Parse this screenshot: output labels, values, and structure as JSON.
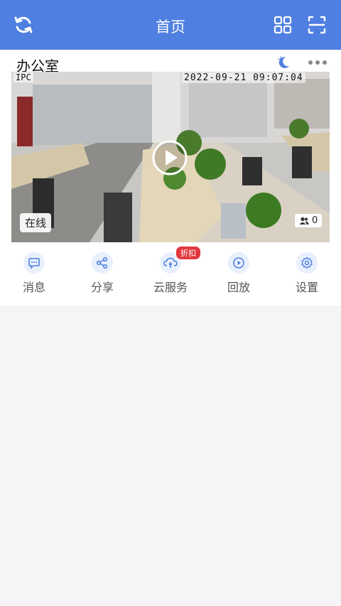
{
  "header": {
    "title": "首页"
  },
  "camera": {
    "name": "办公室",
    "osd_label": "IPC",
    "timestamp": "2022-09-21 09:07:04",
    "status": "在线",
    "viewer_count": "0"
  },
  "actions": [
    {
      "label": "消息",
      "icon": "message-icon"
    },
    {
      "label": "分享",
      "icon": "share-icon"
    },
    {
      "label": "云服务",
      "icon": "cloud-icon",
      "badge": "折扣"
    },
    {
      "label": "回放",
      "icon": "playback-icon"
    },
    {
      "label": "设置",
      "icon": "gear-icon"
    }
  ],
  "colors": {
    "accent": "#4f7fe0",
    "badge": "#e0393e"
  }
}
